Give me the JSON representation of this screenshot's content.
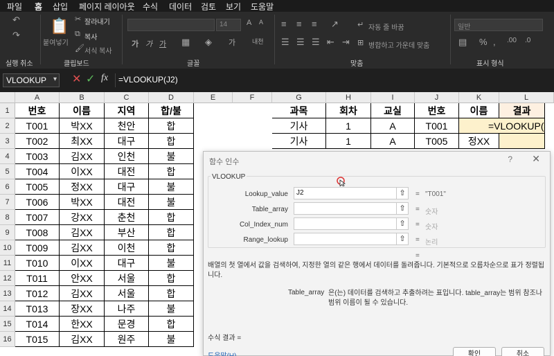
{
  "menubar": {
    "items": [
      "파일",
      "홈",
      "삽입",
      "페이지 레이아웃",
      "수식",
      "데이터",
      "검토",
      "보기",
      "도움말"
    ],
    "active": "홈"
  },
  "ribbon": {
    "clipboard": {
      "paste": "붙여넣기",
      "cut": "잘라내기",
      "copy": "복사",
      "format_painter": "서식 복사",
      "label": "클립보드"
    },
    "undo": {
      "label": "실행 취소"
    },
    "font": {
      "size": "14",
      "label": "글꼴"
    },
    "alignment": {
      "wrap": "자동 줄 바꿈",
      "merge": "병합하고 가운데 맞춤",
      "label": "맞춤"
    },
    "number": {
      "format": "일반",
      "label": "표시 형식"
    }
  },
  "formula_bar": {
    "name_box": "VLOOKUP",
    "fx": "fx",
    "formula": "=VLOOKUP(J2)"
  },
  "columns": [
    "A",
    "B",
    "C",
    "D",
    "E",
    "F",
    "G",
    "H",
    "I",
    "J",
    "K",
    "L"
  ],
  "rows": [
    "1",
    "2",
    "3",
    "4",
    "5",
    "6",
    "7",
    "8",
    "9",
    "10",
    "11",
    "12",
    "13",
    "14",
    "15",
    "16"
  ],
  "table1": {
    "headers": [
      "번호",
      "이름",
      "지역",
      "합/불"
    ],
    "rows": [
      [
        "T001",
        "박XX",
        "천안",
        "합"
      ],
      [
        "T002",
        "최XX",
        "대구",
        "합"
      ],
      [
        "T003",
        "김XX",
        "인천",
        "불"
      ],
      [
        "T004",
        "이XX",
        "대전",
        "합"
      ],
      [
        "T005",
        "정XX",
        "대구",
        "불"
      ],
      [
        "T006",
        "박XX",
        "대전",
        "불"
      ],
      [
        "T007",
        "강XX",
        "춘천",
        "합"
      ],
      [
        "T008",
        "김XX",
        "부산",
        "합"
      ],
      [
        "T009",
        "김XX",
        "이천",
        "합"
      ],
      [
        "T010",
        "이XX",
        "대구",
        "불"
      ],
      [
        "T011",
        "안XX",
        "서울",
        "합"
      ],
      [
        "T012",
        "김XX",
        "서울",
        "합"
      ],
      [
        "T013",
        "장XX",
        "나주",
        "불"
      ],
      [
        "T014",
        "한XX",
        "문경",
        "합"
      ],
      [
        "T015",
        "김XX",
        "원주",
        "불"
      ]
    ]
  },
  "table2": {
    "headers": [
      "과목",
      "회차",
      "교실",
      "번호",
      "이름",
      "결과"
    ],
    "rows": [
      [
        "기사",
        "1",
        "A",
        "T001",
        "",
        "=VLOOKUP(J2"
      ],
      [
        "기사",
        "1",
        "A",
        "T005",
        "정XX",
        ""
      ]
    ]
  },
  "dialog": {
    "title": "함수 인수",
    "help": "?",
    "close": "✕",
    "function_name": "VLOOKUP",
    "args": [
      {
        "label": "Lookup_value",
        "value": "J2",
        "result": "\"T001\""
      },
      {
        "label": "Table_array",
        "value": "",
        "result": "숫자"
      },
      {
        "label": "Col_Index_num",
        "value": "",
        "result": "숫자"
      },
      {
        "label": "Range_lookup",
        "value": "",
        "result": "논리"
      }
    ],
    "eq": "=",
    "description": "배열의 첫 열에서 값을 검색하여, 지정한 열의 같은 행에서 데이터를 돌려줍니다. 기본적으로 오름차순으로 표가 정렬됩니다.",
    "arg_name": "Table_array",
    "arg_description": "은(는) 데이터를 검색하고 추출하려는 표입니다. table_array는 범위 참조나 범위 이름이 될 수 있습니다.",
    "formula_result": "수식 결과 =",
    "help_link": "도움말(H)",
    "ok": "확인",
    "cancel": "취소"
  }
}
